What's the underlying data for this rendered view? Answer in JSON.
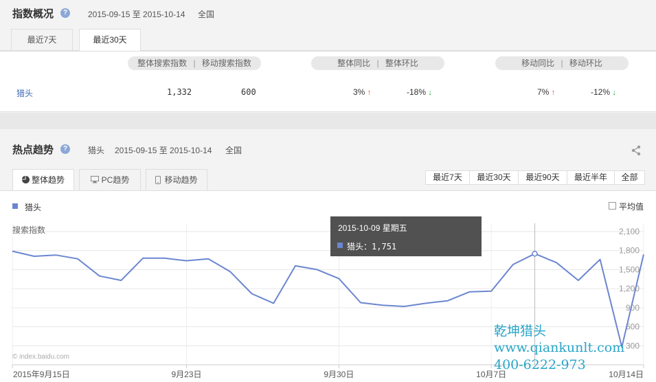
{
  "overview": {
    "title": "指数概况",
    "help": "?",
    "date_range": "2015-09-15 至 2015-10-14",
    "region": "全国",
    "tabs": [
      {
        "label": "最近7天"
      },
      {
        "label": "最近30天"
      }
    ],
    "headers": {
      "search_index": "整体搜索指数",
      "mobile_search_index": "移动搜索指数",
      "overall_yoy": "整体同比",
      "overall_mom": "整体环比",
      "mobile_yoy": "移动同比",
      "mobile_mom": "移动环比",
      "sep": "|"
    },
    "row": {
      "keyword": "猎头",
      "overall": "1,332",
      "mobile": "600",
      "overall_yoy": "3%",
      "overall_mom": "-18%",
      "mobile_yoy": "7%",
      "mobile_mom": "-12%",
      "up_arrow": "↑",
      "down_arrow": "↓"
    },
    "colors": {
      "up": "#e4573b",
      "down": "#26a53a"
    }
  },
  "trend": {
    "title": "热点趋势",
    "help": "?",
    "keyword": "猎头",
    "date_range": "2015-09-15 至 2015-10-14",
    "region": "全国",
    "tabs": [
      {
        "label": "整体趋势",
        "icon": "pie-chart-icon"
      },
      {
        "label": "PC趋势",
        "icon": "monitor-icon"
      },
      {
        "label": "移动趋势",
        "icon": "mobile-icon"
      }
    ],
    "ranges": [
      "最近7天",
      "最近30天",
      "最近90天",
      "最近半年",
      "全部"
    ],
    "legend": "猎头",
    "avg_label": "平均值",
    "source": "© index.baidu.com",
    "tooltip": {
      "date": "2015-10-09 星期五",
      "series": "猎头",
      "sep": "：",
      "value": "1,751"
    }
  },
  "watermark": {
    "line1": "乾坤猎头",
    "line2": "www.qiankunlt.com",
    "line3": "400-6222-973"
  },
  "chart_data": {
    "type": "line",
    "ylabel": "搜索指数",
    "ylim": [
      0,
      2100
    ],
    "yticks": [
      "2,100",
      "1,800",
      "1,500",
      "1,200",
      "900",
      "600",
      "300"
    ],
    "xtick_labels": [
      "2015年9月15日",
      "9月23日",
      "9月30日",
      "10月7日",
      "10月14日"
    ],
    "xtick_index": [
      0,
      8,
      15,
      22,
      29
    ],
    "series": [
      {
        "name": "猎头",
        "color": "#6b86d0",
        "x": [
          "2015-09-15",
          "2015-09-16",
          "2015-09-17",
          "2015-09-18",
          "2015-09-19",
          "2015-09-20",
          "2015-09-21",
          "2015-09-22",
          "2015-09-23",
          "2015-09-24",
          "2015-09-25",
          "2015-09-26",
          "2015-09-27",
          "2015-09-28",
          "2015-09-29",
          "2015-09-30",
          "2015-10-01",
          "2015-10-02",
          "2015-10-03",
          "2015-10-04",
          "2015-10-05",
          "2015-10-06",
          "2015-10-07",
          "2015-10-08",
          "2015-10-09",
          "2015-10-10",
          "2015-10-11",
          "2015-10-12",
          "2015-10-13",
          "2015-10-14"
        ],
        "values": [
          1790,
          1710,
          1730,
          1670,
          1400,
          1330,
          1680,
          1680,
          1640,
          1670,
          1470,
          1120,
          970,
          1560,
          1500,
          1360,
          980,
          940,
          920,
          970,
          1010,
          1150,
          1160,
          1580,
          1751,
          1610,
          1330,
          1660,
          280,
          1740
        ],
        "highlight_index": 24
      }
    ],
    "grid": true
  }
}
